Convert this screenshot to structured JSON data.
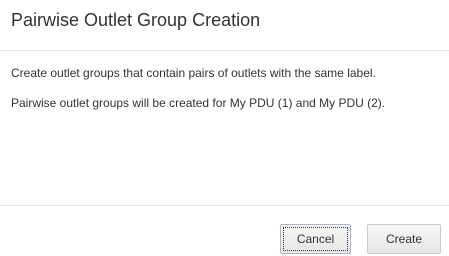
{
  "dialog": {
    "title": "Pairwise Outlet Group Creation",
    "body": {
      "paragraph_1": "Create outlet groups that contain pairs of outlets with the same label.",
      "paragraph_2": "Pairwise outlet groups will be created for My PDU (1) and My PDU (2)."
    },
    "buttons": {
      "cancel_label": "Cancel",
      "create_label": "Create"
    }
  }
}
